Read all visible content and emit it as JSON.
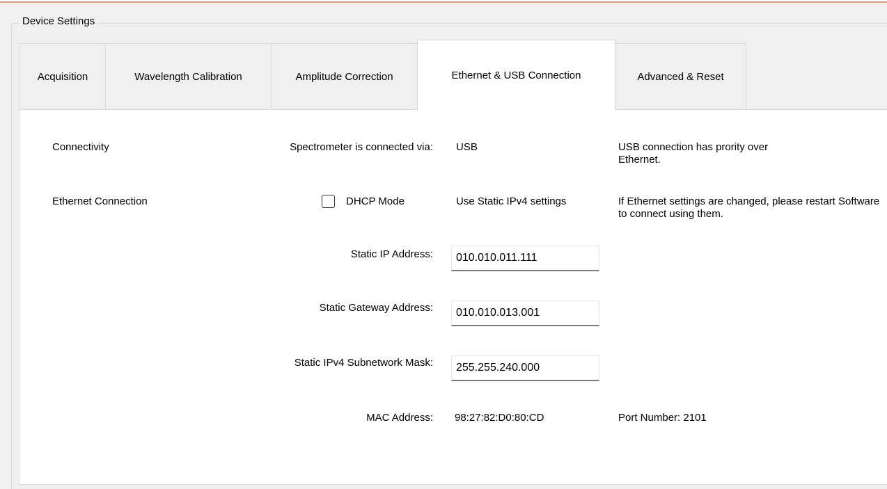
{
  "group": {
    "title": "Device Settings"
  },
  "tabs": [
    {
      "label": "Acquisition",
      "active": false
    },
    {
      "label": "Wavelength Calibration",
      "active": false
    },
    {
      "label": "Amplitude Correction",
      "active": false
    },
    {
      "label": "Ethernet & USB Connection",
      "active": true
    },
    {
      "label": "Advanced & Reset",
      "active": false
    }
  ],
  "connectivity": {
    "section_label": "Connectivity",
    "connected_via_label": "Spectrometer is connected via:",
    "connected_via_value": "USB",
    "note": "USB connection has prority over Ethernet."
  },
  "ethernet": {
    "section_label": "Ethernet Connection",
    "dhcp_label": "DHCP Mode",
    "dhcp_checked": false,
    "mode_value": "Use Static IPv4 settings",
    "note": "If Ethernet settings are changed, please restart Software to connect using them.",
    "static_ip_label": "Static IP Address:",
    "static_ip_value": "010.010.011.111",
    "gateway_label": "Static Gateway Address:",
    "gateway_value": "010.010.013.001",
    "subnet_label": "Static IPv4 Subnetwork Mask:",
    "subnet_value": "255.255.240.000",
    "mac_label": "MAC Address:",
    "mac_value": "98:27:82:D0:80:CD",
    "port_label": "Port Number: 2101"
  },
  "colors": {
    "accent_line": "#d99a82",
    "tab_bg": "#f0f0f0",
    "page_bg": "#ffffff"
  }
}
